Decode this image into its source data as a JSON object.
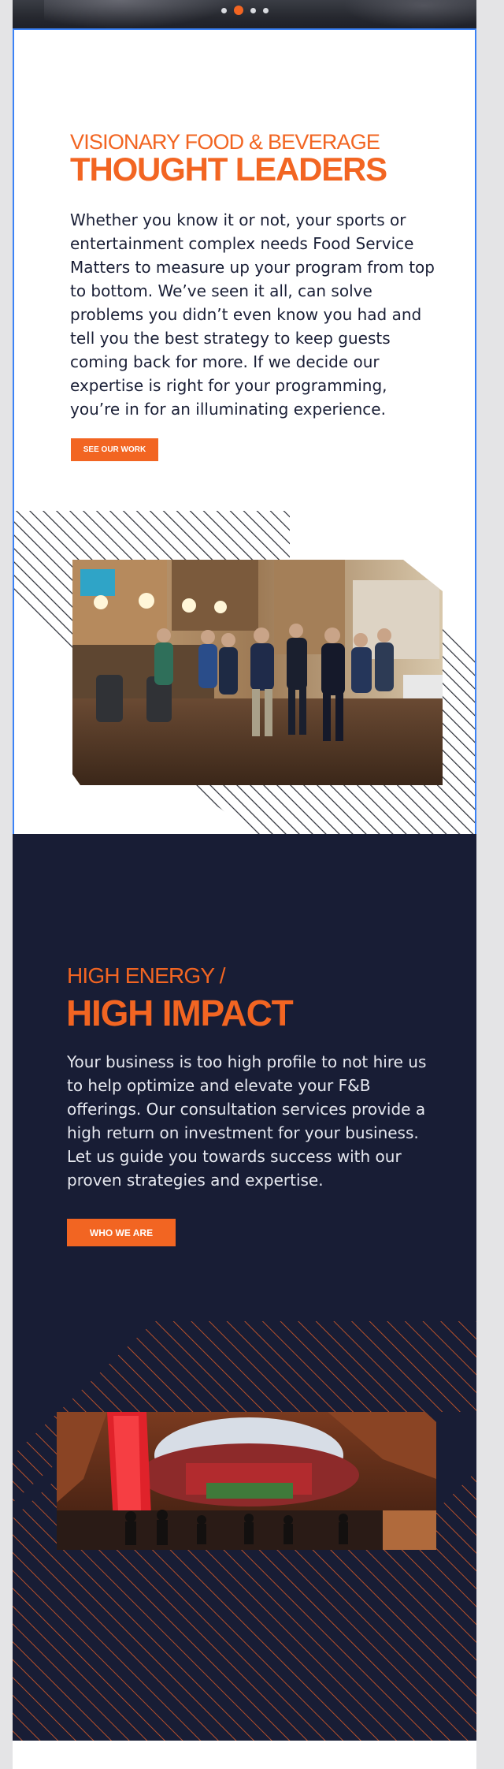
{
  "slider": {
    "dots": [
      {
        "label": "slide-1",
        "active": false
      },
      {
        "label": "slide-2",
        "active": true
      },
      {
        "label": "slide-3",
        "active": false
      },
      {
        "label": "slide-4",
        "active": false
      }
    ]
  },
  "section_thought_leaders": {
    "eyebrow": "VISIONARY FOOD & BEVERAGE",
    "headline": "THOUGHT LEADERS",
    "body": "Whether you know it or not, your sports or entertainment complex needs Food Service Matters to measure up your program from top to bottom. We’ve seen it all, can solve problems you didn’t even know you had and tell you the best strategy to keep guests coming back for more. If we decide our expertise is right for your programming, you’re in for an illuminating experience.",
    "cta_label": "SEE OUR WORK",
    "image_subject": "restaurant-bar-crowd-photo"
  },
  "section_high_impact": {
    "eyebrow": "HIGH ENERGY /",
    "headline": "HIGH IMPACT",
    "body": "Your business is too high profile to not hire us to help optimize and elevate your F&B offerings. Our consultation services provide a high return on investment for your business. Let us guide you towards success with our proven strategies and expertise.",
    "cta_label": "WHO WE ARE",
    "image_subject": "stadium-interior-photo"
  },
  "colors": {
    "accent": "#f26522",
    "navy": "#181d35",
    "text_dark": "#1a1f36",
    "text_light": "#e6e8ef",
    "selection_outline": "#3b82f6"
  }
}
